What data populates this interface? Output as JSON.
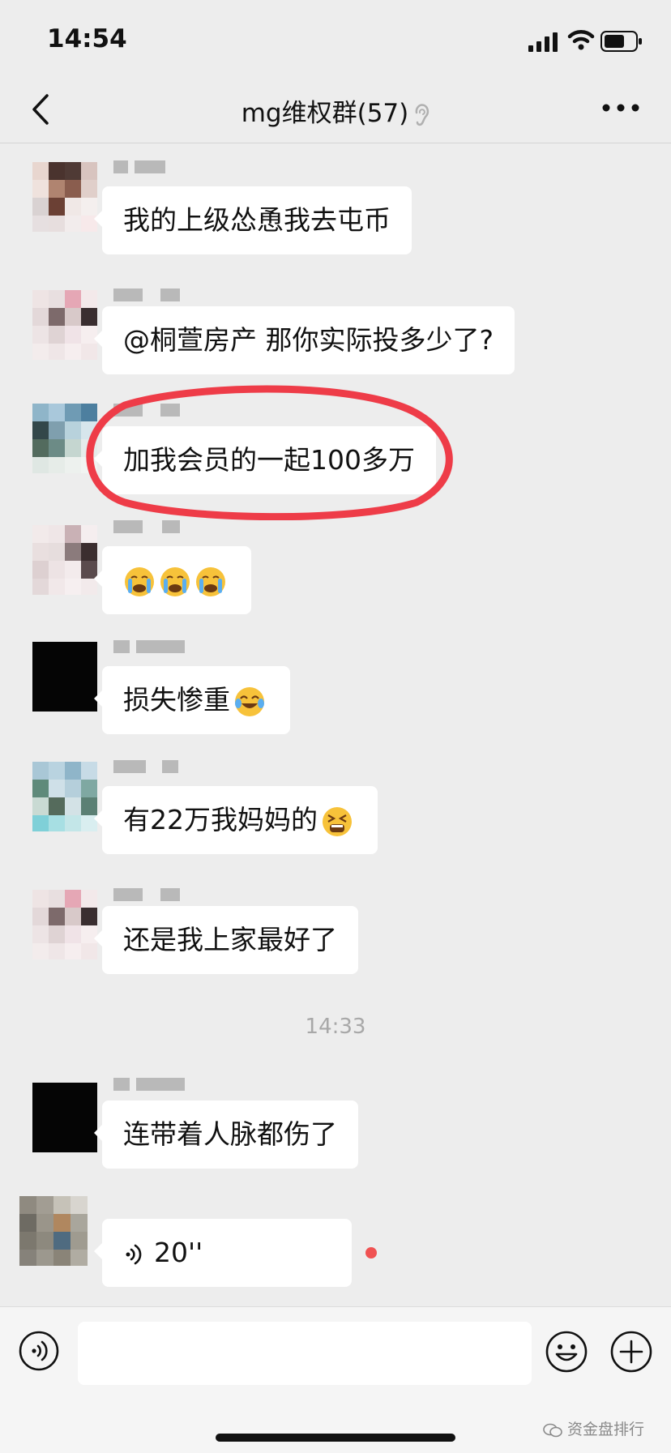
{
  "status_bar": {
    "time": "14:54",
    "signal_icon": "cellular-signal-icon",
    "wifi_icon": "wifi-icon",
    "battery_icon": "battery-icon"
  },
  "nav": {
    "title": "mg维权群(57)",
    "back_icon": "chevron-left-icon",
    "mute_icon": "ear-icon",
    "more_icon": "more-dots-icon"
  },
  "messages": [
    {
      "text": "我的上级怂恿我去屯币"
    },
    {
      "text": "@桐萱房产  那你实际投多少了?"
    },
    {
      "text": "加我会员的一起100多万",
      "highlighted": true
    },
    {
      "text": "",
      "emoji": [
        "loudly-crying-face-icon",
        "loudly-crying-face-icon",
        "loudly-crying-face-icon"
      ]
    },
    {
      "text": "损失惨重",
      "emoji_after": "tears-of-joy-icon"
    },
    {
      "text": "有22万我妈妈的",
      "emoji_after": "tired-face-icon"
    },
    {
      "text": "还是我上家最好了"
    },
    {
      "text": "连带着人脉都伤了"
    },
    {
      "text": "20''",
      "type": "voice",
      "voice_icon": "voice-wave-icon",
      "unread": true
    }
  ],
  "time_separator": "14:33",
  "input_bar": {
    "voice_icon": "voice-toggle-icon",
    "emoji_icon": "smiley-icon",
    "plus_icon": "plus-icon",
    "watermark": "资金盘排行"
  },
  "colors": {
    "background": "#ededed",
    "bubble": "#ffffff",
    "highlight": "#ee3c48",
    "unread_dot": "#f05252"
  }
}
